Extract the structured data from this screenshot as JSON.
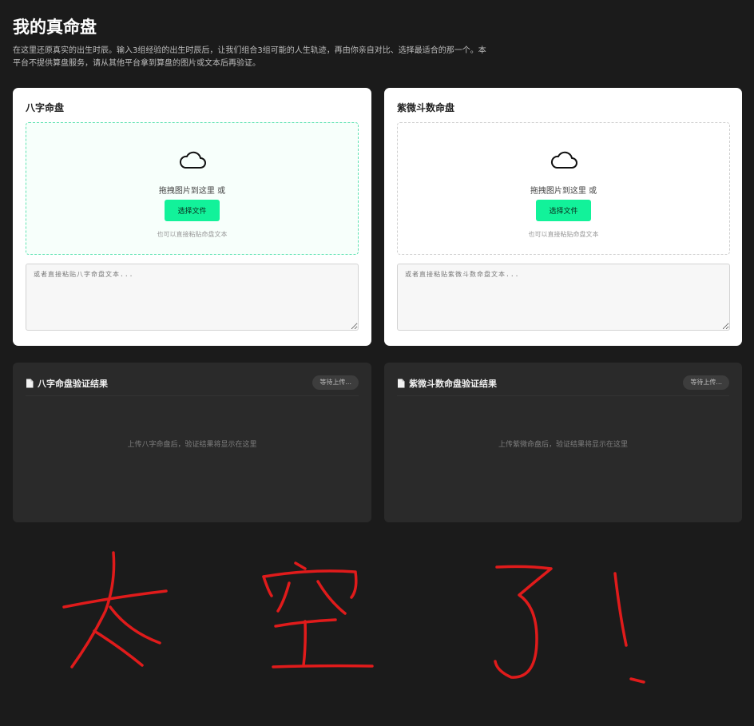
{
  "header": {
    "title": "我的真命盘",
    "description": "在这里还原真实的出生时辰。输入3组经验的出生时辰后，让我们组合3组可能的人生轨迹，再由你亲自对比、选择最适合的那一个。本平台不提供算盘服务，请从其他平台拿到算盘的图片或文本后再验证。"
  },
  "upload_cards": [
    {
      "title": "八字命盘",
      "drop_text": "拖拽图片到这里 或",
      "button_label": "选择文件",
      "hint": "也可以直接粘贴命盘文本",
      "textarea_placeholder": "或者直接粘贴八字命盘文本...",
      "icon": "cloud-icon"
    },
    {
      "title": "紫微斗数命盘",
      "drop_text": "拖拽图片到这里 或",
      "button_label": "选择文件",
      "hint": "也可以直接粘贴命盘文本",
      "textarea_placeholder": "或者直接粘贴紫微斗数命盘文本...",
      "icon": "cloud-icon"
    }
  ],
  "result_cards": [
    {
      "title": "八字命盘验证结果",
      "status": "等待上传...",
      "empty_text": "上传八字命盘后，验证结果将显示在这里",
      "icon": "document-icon"
    },
    {
      "title": "紫微斗数命盘验证结果",
      "status": "等待上传...",
      "empty_text": "上传紫微命盘后，验证结果将显示在这里",
      "icon": "document-icon"
    }
  ],
  "annotation": {
    "text": "太 空 了 !",
    "color": "#e01b1b"
  },
  "colors": {
    "background": "#1b1b1b",
    "accent": "#12f29a",
    "card": "#ffffff",
    "result_card": "#2a2a2a"
  }
}
